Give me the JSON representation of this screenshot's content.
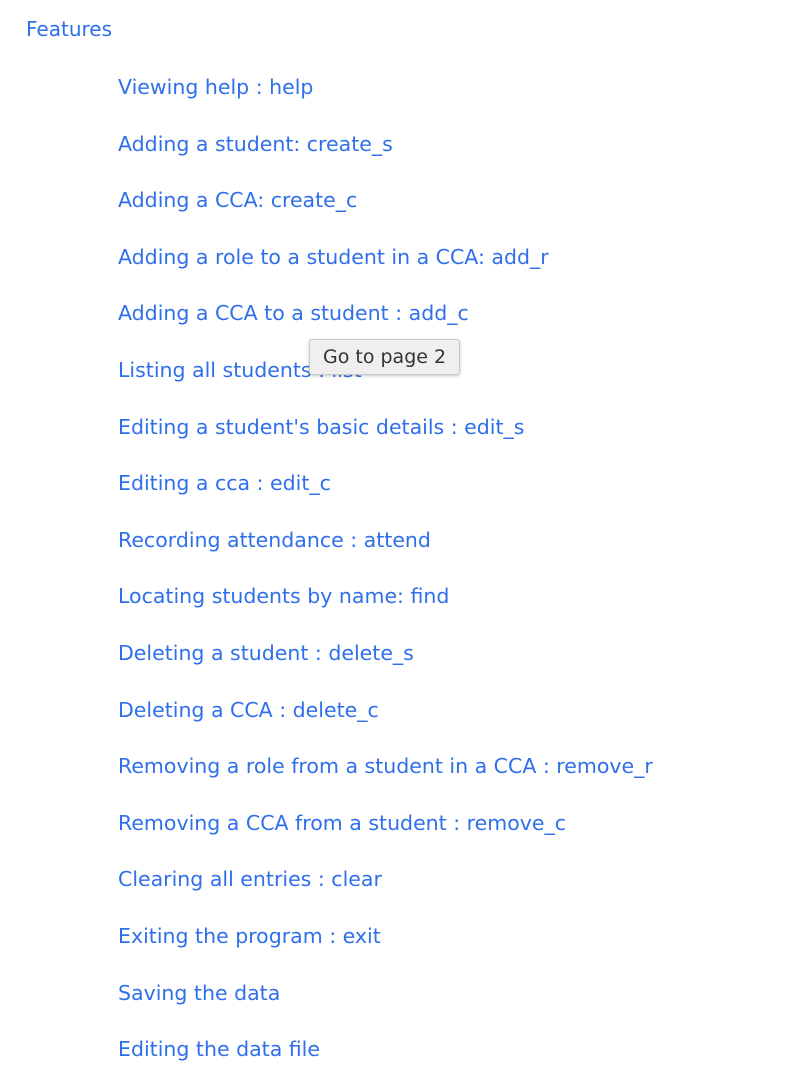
{
  "toc": {
    "heading": "Features",
    "items": [
      {
        "label": "Viewing help : help"
      },
      {
        "label": "Adding a student: create_s"
      },
      {
        "label": "Adding a CCA: create_c"
      },
      {
        "label": "Adding a role to a student in a CCA: add_r"
      },
      {
        "label": "Adding a CCA to a student : add_c"
      },
      {
        "label": "Listing all students : list"
      },
      {
        "label": "Editing a student's basic details : edit_s"
      },
      {
        "label": "Editing a cca : edit_c"
      },
      {
        "label": "Recording attendance : attend"
      },
      {
        "label": "Locating students by name: find"
      },
      {
        "label": "Deleting a student : delete_s"
      },
      {
        "label": "Deleting a CCA : delete_c"
      },
      {
        "label": "Removing a role from a student in a CCA : remove_r"
      },
      {
        "label": "Removing a CCA from a student : remove_c"
      },
      {
        "label": "Clearing all entries : clear"
      },
      {
        "label": "Exiting the program : exit"
      },
      {
        "label": "Saving the data"
      },
      {
        "label": "Editing the data file"
      }
    ]
  },
  "tooltip": {
    "text": "Go to page 2"
  },
  "colors": {
    "link": "#2f6fea",
    "tooltip_bg": "#efefef",
    "tooltip_text": "#333333"
  }
}
